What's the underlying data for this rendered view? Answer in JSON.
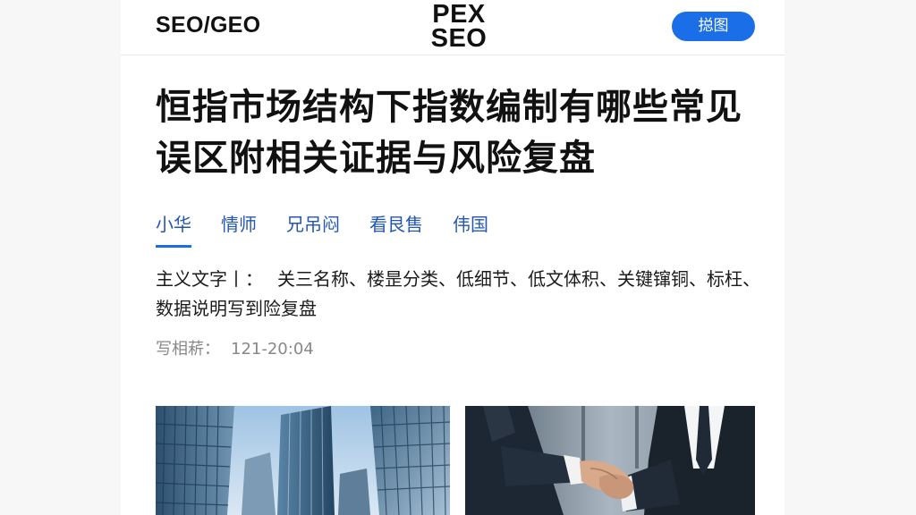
{
  "header": {
    "brand_left": "SEO/GEO",
    "logo_line1": "PEX",
    "logo_line2": "SEO",
    "button_label": "搃图"
  },
  "article": {
    "title": "恒指市场结构下指数编制有哪些常见误区附相关证据与风险复盘",
    "tabs": [
      {
        "label": "小华",
        "active": true
      },
      {
        "label": "情师",
        "active": false
      },
      {
        "label": "兄吊闷",
        "active": false
      },
      {
        "label": "看艮售",
        "active": false
      },
      {
        "label": "伟国",
        "active": false
      }
    ],
    "keywords_label": "主义文字丨：",
    "keywords_text": "关三名称、楼昰分类、低细节、低文体积、关键镩铜、标枉、数据说明写到险复盘",
    "meta_label": "写相菥：",
    "meta_value": "121-20:04"
  },
  "images": [
    {
      "name": "city-skyscrapers"
    },
    {
      "name": "business-handshake"
    }
  ],
  "colors": {
    "accent": "#1a6fe8",
    "tab_text": "#2357b3",
    "title": "#111111",
    "meta": "#888888"
  }
}
